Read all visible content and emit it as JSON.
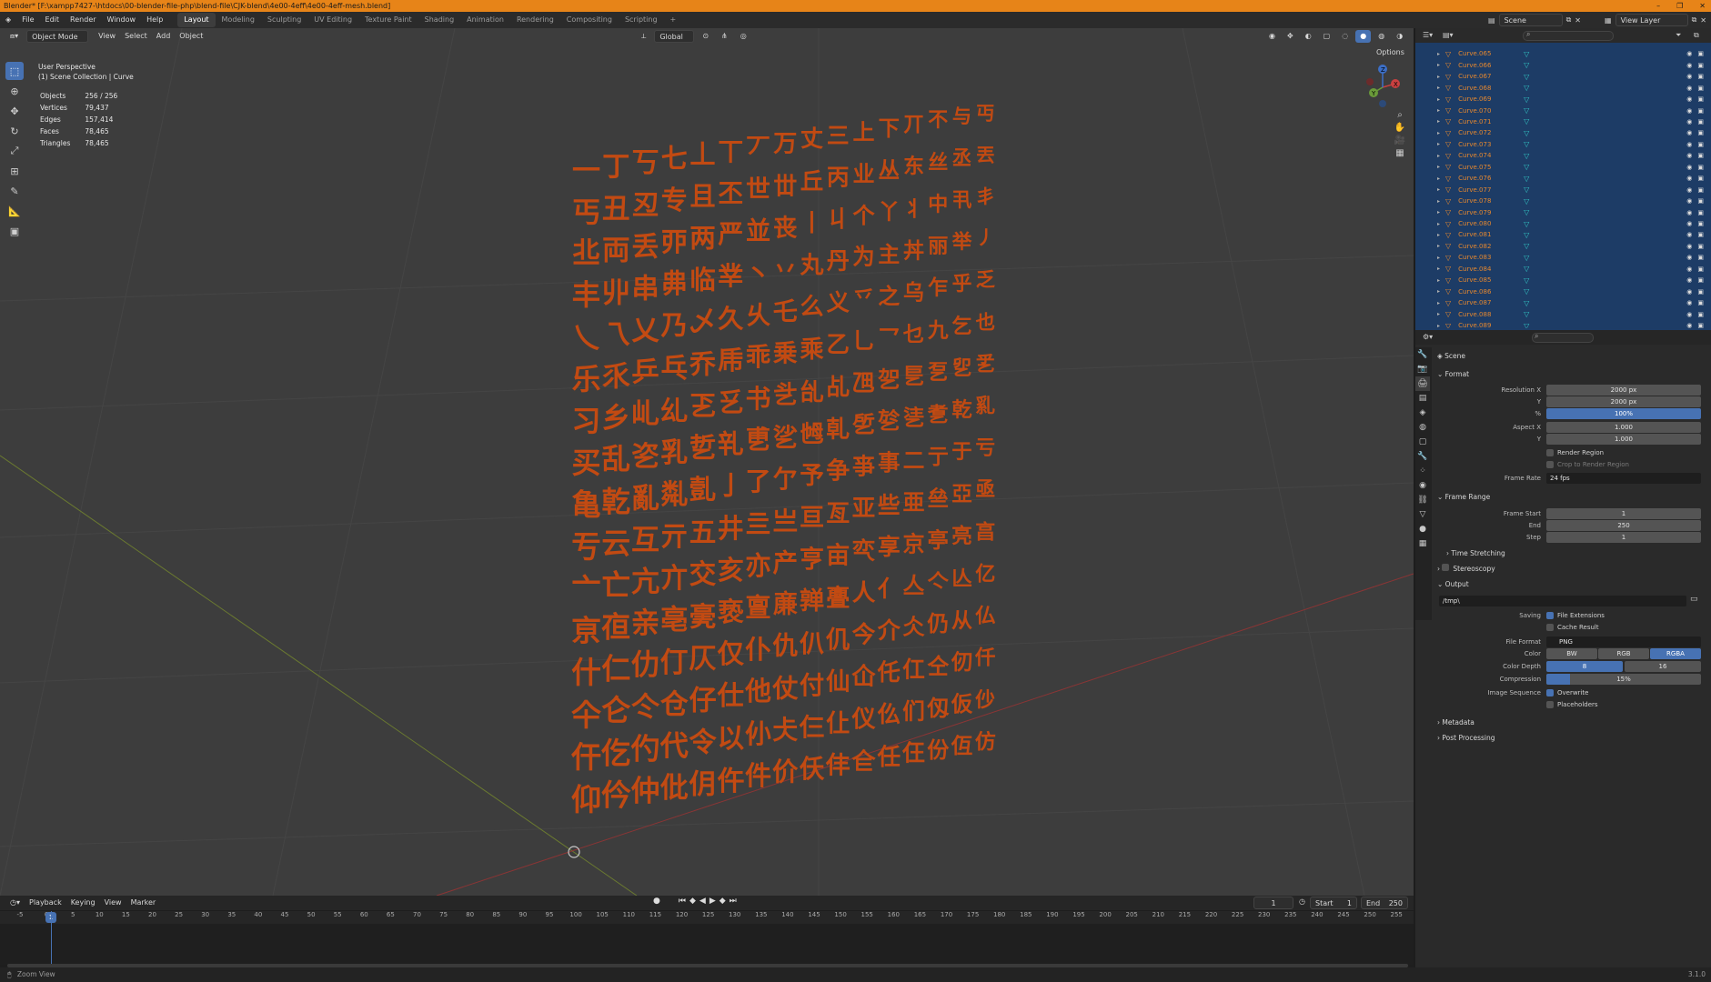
{
  "window": {
    "title": "Blender* [F:\\xampp7427-\\htdocs\\00-blender-file-php\\blend-file\\CJK-blend\\4e00-4eff\\4e00-4eff-mesh.blend]",
    "minimize": "–",
    "maximize": "❐",
    "close": "✕"
  },
  "menus": [
    "File",
    "Edit",
    "Render",
    "Window",
    "Help"
  ],
  "workspaces": [
    "Layout",
    "Modeling",
    "Sculpting",
    "UV Editing",
    "Texture Paint",
    "Shading",
    "Animation",
    "Rendering",
    "Compositing",
    "Scripting"
  ],
  "workspace_add": "+",
  "scene_selector": {
    "icon": "scene-icon",
    "value": "Scene"
  },
  "view_layer_selector": {
    "value": "View Layer"
  },
  "viewport_header": {
    "mode": "Object Mode",
    "menus": [
      "View",
      "Select",
      "Add",
      "Object"
    ],
    "orientation": "Global",
    "options": "Options"
  },
  "viewport_info": {
    "line1": "User Perspective",
    "line2": "(1) Scene Collection | Curve"
  },
  "stats": [
    {
      "label": "Objects",
      "value": "256 / 256"
    },
    {
      "label": "Vertices",
      "value": "79,437"
    },
    {
      "label": "Edges",
      "value": "157,414"
    },
    {
      "label": "Faces",
      "value": "78,465"
    },
    {
      "label": "Triangles",
      "value": "78,465"
    }
  ],
  "gizmo": {
    "x": "X",
    "y": "Y",
    "z": "Z"
  },
  "glyph_rows": [
    "一丁丂七丄丅丆万丈三上下丌不与丏",
    "丐丑丒专且丕世丗丘丙业丛东丝丞丟",
    "丠両丢丣两严並丧丨丩个丫丬中丮丯",
    "丰丱串丳临丵丶丷丸丹为主丼丽举丿",
    "乀乁乂乃乄久乆乇么义乊之乌乍乎乏",
    "乐乑乒乓乔乕乖乗乘乙乚乛乜九乞也",
    "习乡乢乣乤乥书乧乨乩乪乫乬乭乮乯",
    "买乱乲乳乴乵乶乷乸乹乺乻乼乽乾乿",
    "亀亁亂亃亄亅了亇予争亊事二亍于亏",
    "亐云互亓五井亖亗亘亙亚些亜亝亞亟",
    "亠亡亢亣交亥亦产亨亩亪享京亭亮亯",
    "亰亱亲亳亴亵亶亷亸亹人亻亼亽亾亿",
    "什仁仂仃仄仅仆仇仈仉今介仌仍从仏",
    "仐仑仒仓仔仕他仗付仙仚仛仜仝仞仟",
    "仠仡仢代令以仦仧仨仩仪仫们仭仮仯",
    "仰仱仲仳仴仵件价仸仹仺任仼份仾仿"
  ],
  "outliner": {
    "rows": [
      "Curve.065",
      "Curve.066",
      "Curve.067",
      "Curve.068",
      "Curve.069",
      "Curve.070",
      "Curve.071",
      "Curve.072",
      "Curve.073",
      "Curve.074",
      "Curve.075",
      "Curve.076",
      "Curve.077",
      "Curve.078",
      "Curve.079",
      "Curve.080",
      "Curve.081",
      "Curve.082",
      "Curve.083",
      "Curve.084",
      "Curve.085",
      "Curve.086",
      "Curve.087",
      "Curve.088",
      "Curve.089"
    ]
  },
  "properties": {
    "context": "Scene",
    "format": {
      "title": "Format",
      "res_x_label": "Resolution X",
      "res_x": "2000 px",
      "res_y_label": "Y",
      "res_y": "2000 px",
      "pct_label": "%",
      "pct": "100%",
      "aspect_x_label": "Aspect X",
      "aspect_x": "1.000",
      "aspect_y_label": "Y",
      "aspect_y": "1.000",
      "render_region": "Render Region",
      "crop": "Crop to Render Region",
      "frame_rate_label": "Frame Rate",
      "frame_rate": "24 fps"
    },
    "frame_range": {
      "title": "Frame Range",
      "start_label": "Frame Start",
      "start": "1",
      "end_label": "End",
      "end": "250",
      "step_label": "Step",
      "step": "1",
      "time_stretching": "Time Stretching"
    },
    "stereoscopy": "Stereoscopy",
    "output": {
      "title": "Output",
      "path": "/tmp\\",
      "saving_label": "Saving",
      "file_extensions": "File Extensions",
      "cache_result": "Cache Result",
      "file_format_label": "File Format",
      "file_format": "PNG",
      "color_label": "Color",
      "color_options": [
        "BW",
        "RGB",
        "RGBA"
      ],
      "color_selected": "RGBA",
      "depth_label": "Color Depth",
      "depth_options": [
        "8",
        "16"
      ],
      "depth_selected": "8",
      "compression_label": "Compression",
      "compression": "15%",
      "compression_value": 0.15,
      "image_seq_label": "Image Sequence",
      "overwrite": "Overwrite",
      "placeholders": "Placeholders"
    },
    "metadata": "Metadata",
    "post_processing": "Post Processing"
  },
  "timeline": {
    "menus": [
      "Playback",
      "Keying",
      "View",
      "Marker"
    ],
    "current_frame": "1",
    "start_label": "Start",
    "start": "1",
    "end_label": "End",
    "end": "250",
    "ticks": [
      "-5",
      "0",
      "5",
      "10",
      "15",
      "20",
      "25",
      "30",
      "35",
      "40",
      "45",
      "50",
      "55",
      "60",
      "65",
      "70",
      "75",
      "80",
      "85",
      "90",
      "95",
      "100",
      "105",
      "110",
      "115",
      "120",
      "125",
      "130",
      "135",
      "140",
      "145",
      "150",
      "155",
      "160",
      "165",
      "170",
      "175",
      "180",
      "185",
      "190",
      "195",
      "200",
      "205",
      "210",
      "215",
      "220",
      "225",
      "230",
      "235",
      "240",
      "245",
      "250",
      "255"
    ],
    "cursor": "1"
  },
  "status": {
    "left": "Zoom View",
    "version": "3.1.0"
  },
  "colors": {
    "accent": "#4772b3",
    "title_bar": "#e78418",
    "glyph": "#c24a12",
    "outliner_bg": "#1d3c66"
  }
}
